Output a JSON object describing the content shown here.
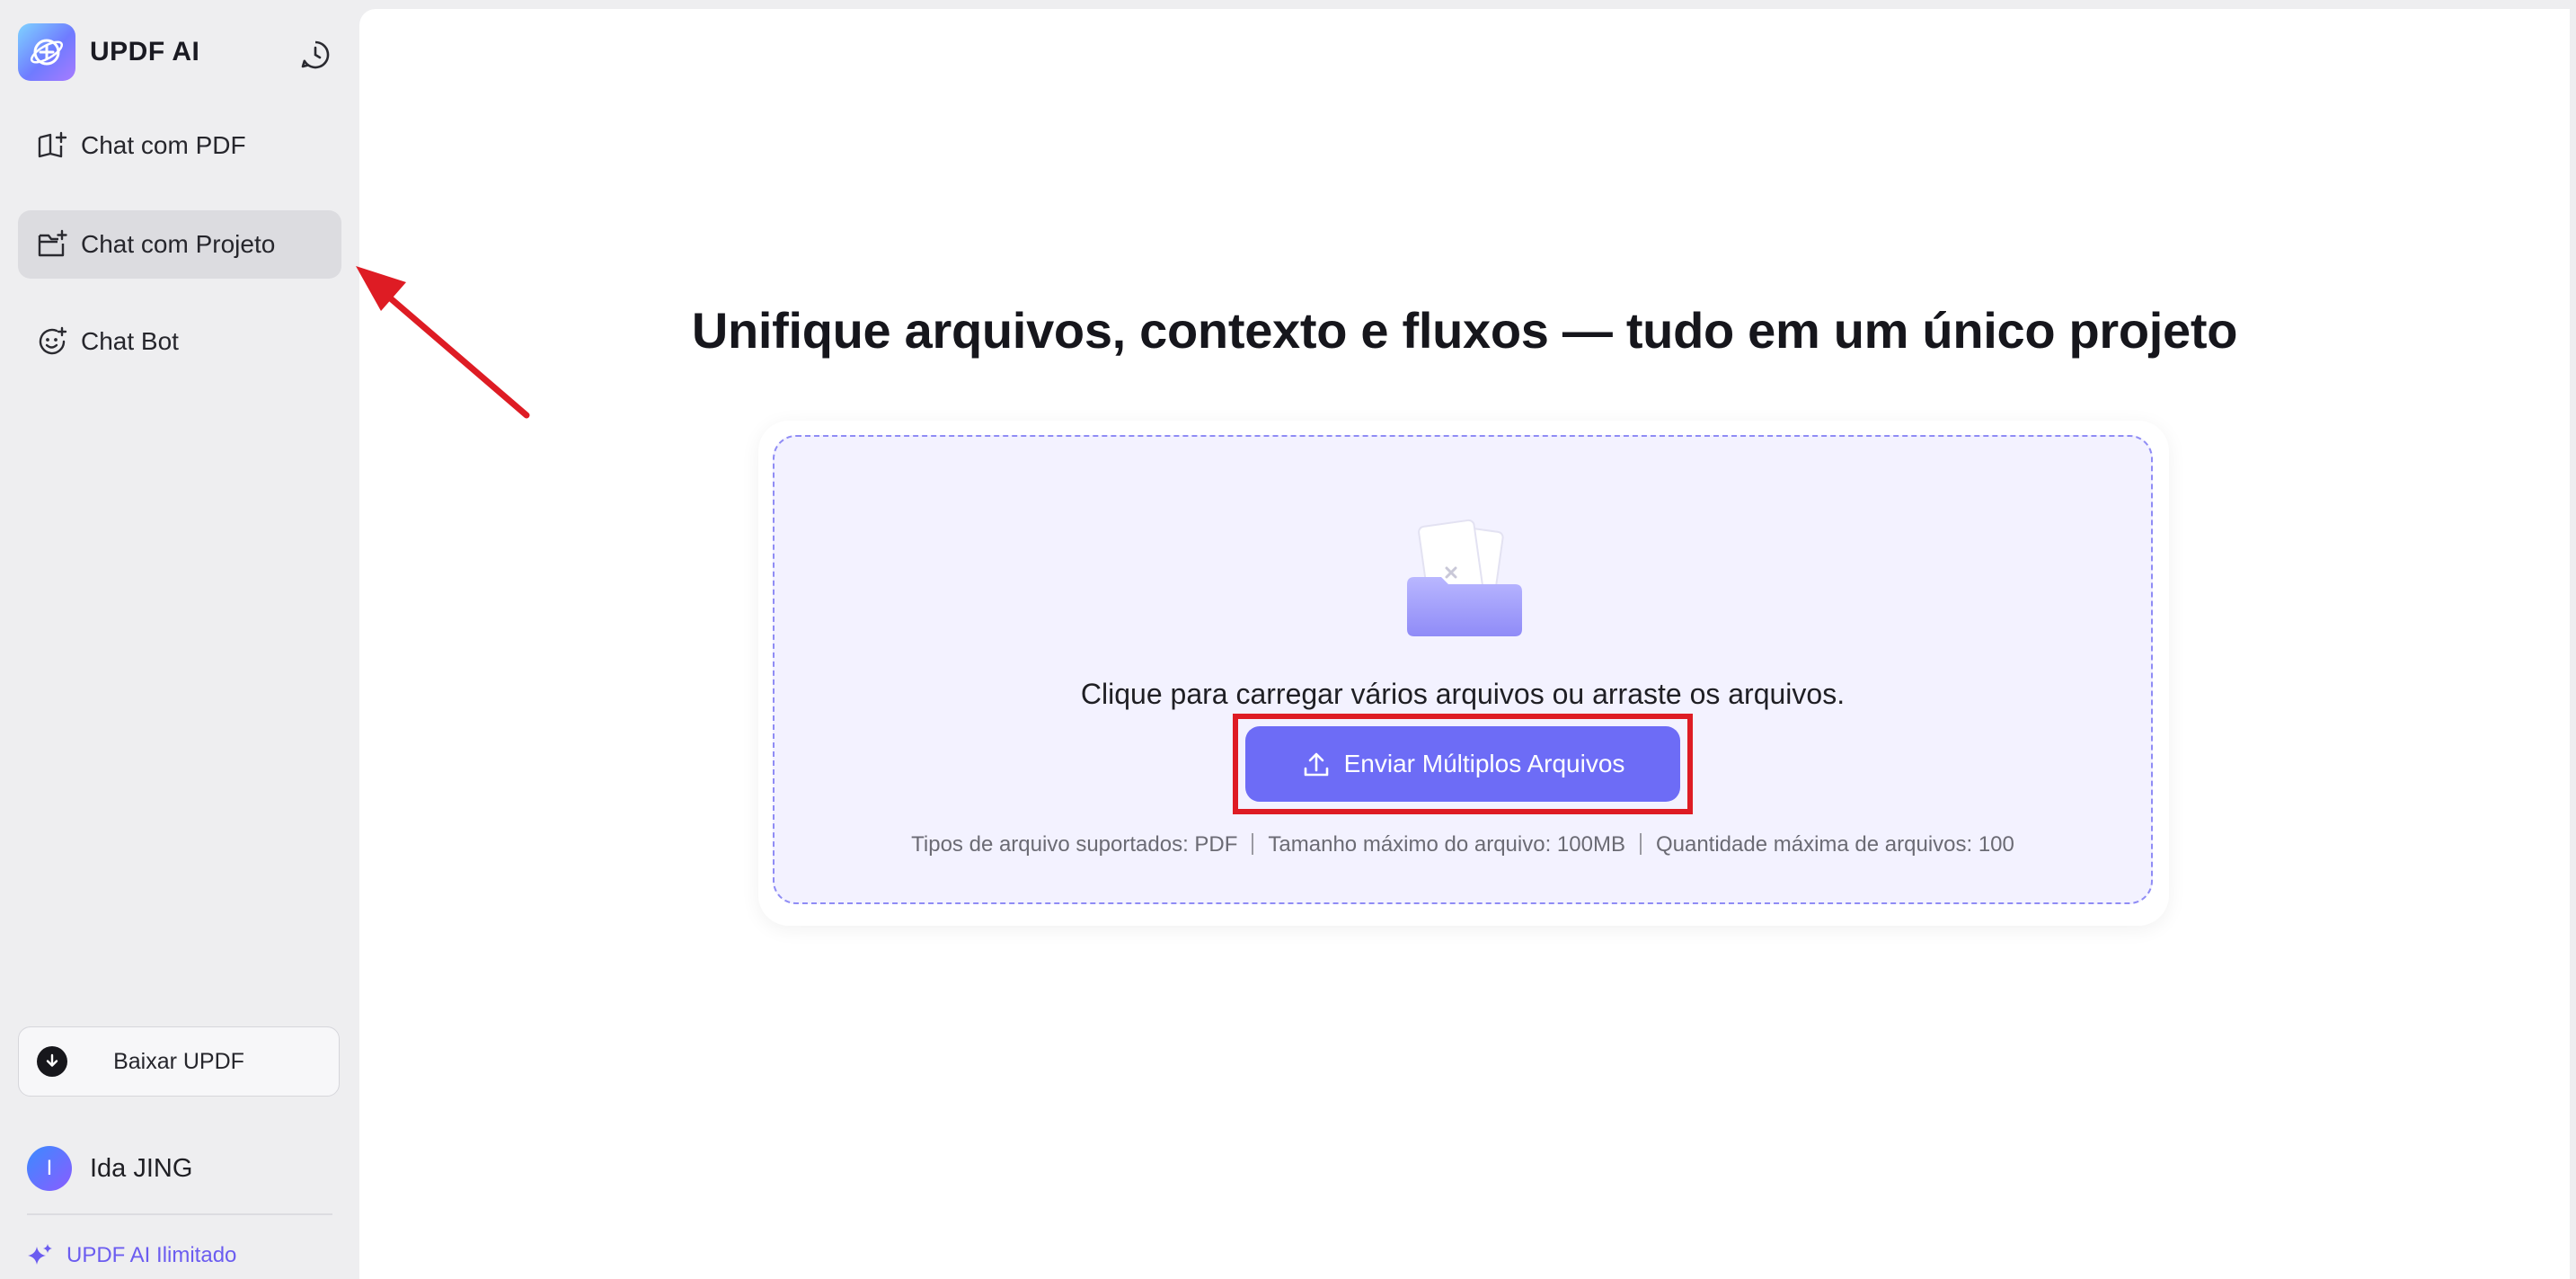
{
  "brand": {
    "name": "UPDF AI",
    "logo_icon": "updf-ai-logo-icon",
    "accent": "#6d6cf6"
  },
  "sidebar": {
    "history_icon": "chat-history-icon",
    "items": [
      {
        "label": "Chat com PDF",
        "icon": "book-sparkle-icon",
        "active": false
      },
      {
        "label": "Chat com Projeto",
        "icon": "folder-sparkle-icon",
        "active": true
      },
      {
        "label": "Chat Bot",
        "icon": "bot-face-icon",
        "active": false
      }
    ],
    "download_label": "Baixar UPDF",
    "user": {
      "initial": "I",
      "name": "Ida JING"
    },
    "upgrade_label": "UPDF AI Ilimitado"
  },
  "main": {
    "headline": "Unifique arquivos, contexto e fluxos — tudo em um único projeto",
    "dropzone": {
      "instruction": "Clique para carregar vários arquivos ou arraste os arquivos.",
      "upload_button": "Enviar Múltiplos Arquivos",
      "file_info": [
        "Tipos de arquivo suportados: PDF",
        "Tamanho máximo do arquivo: 100MB",
        "Quantidade máxima de arquivos: 100"
      ]
    }
  },
  "annotation": {
    "highlight_color": "#de1c24",
    "arrow_color": "#de1c24"
  }
}
